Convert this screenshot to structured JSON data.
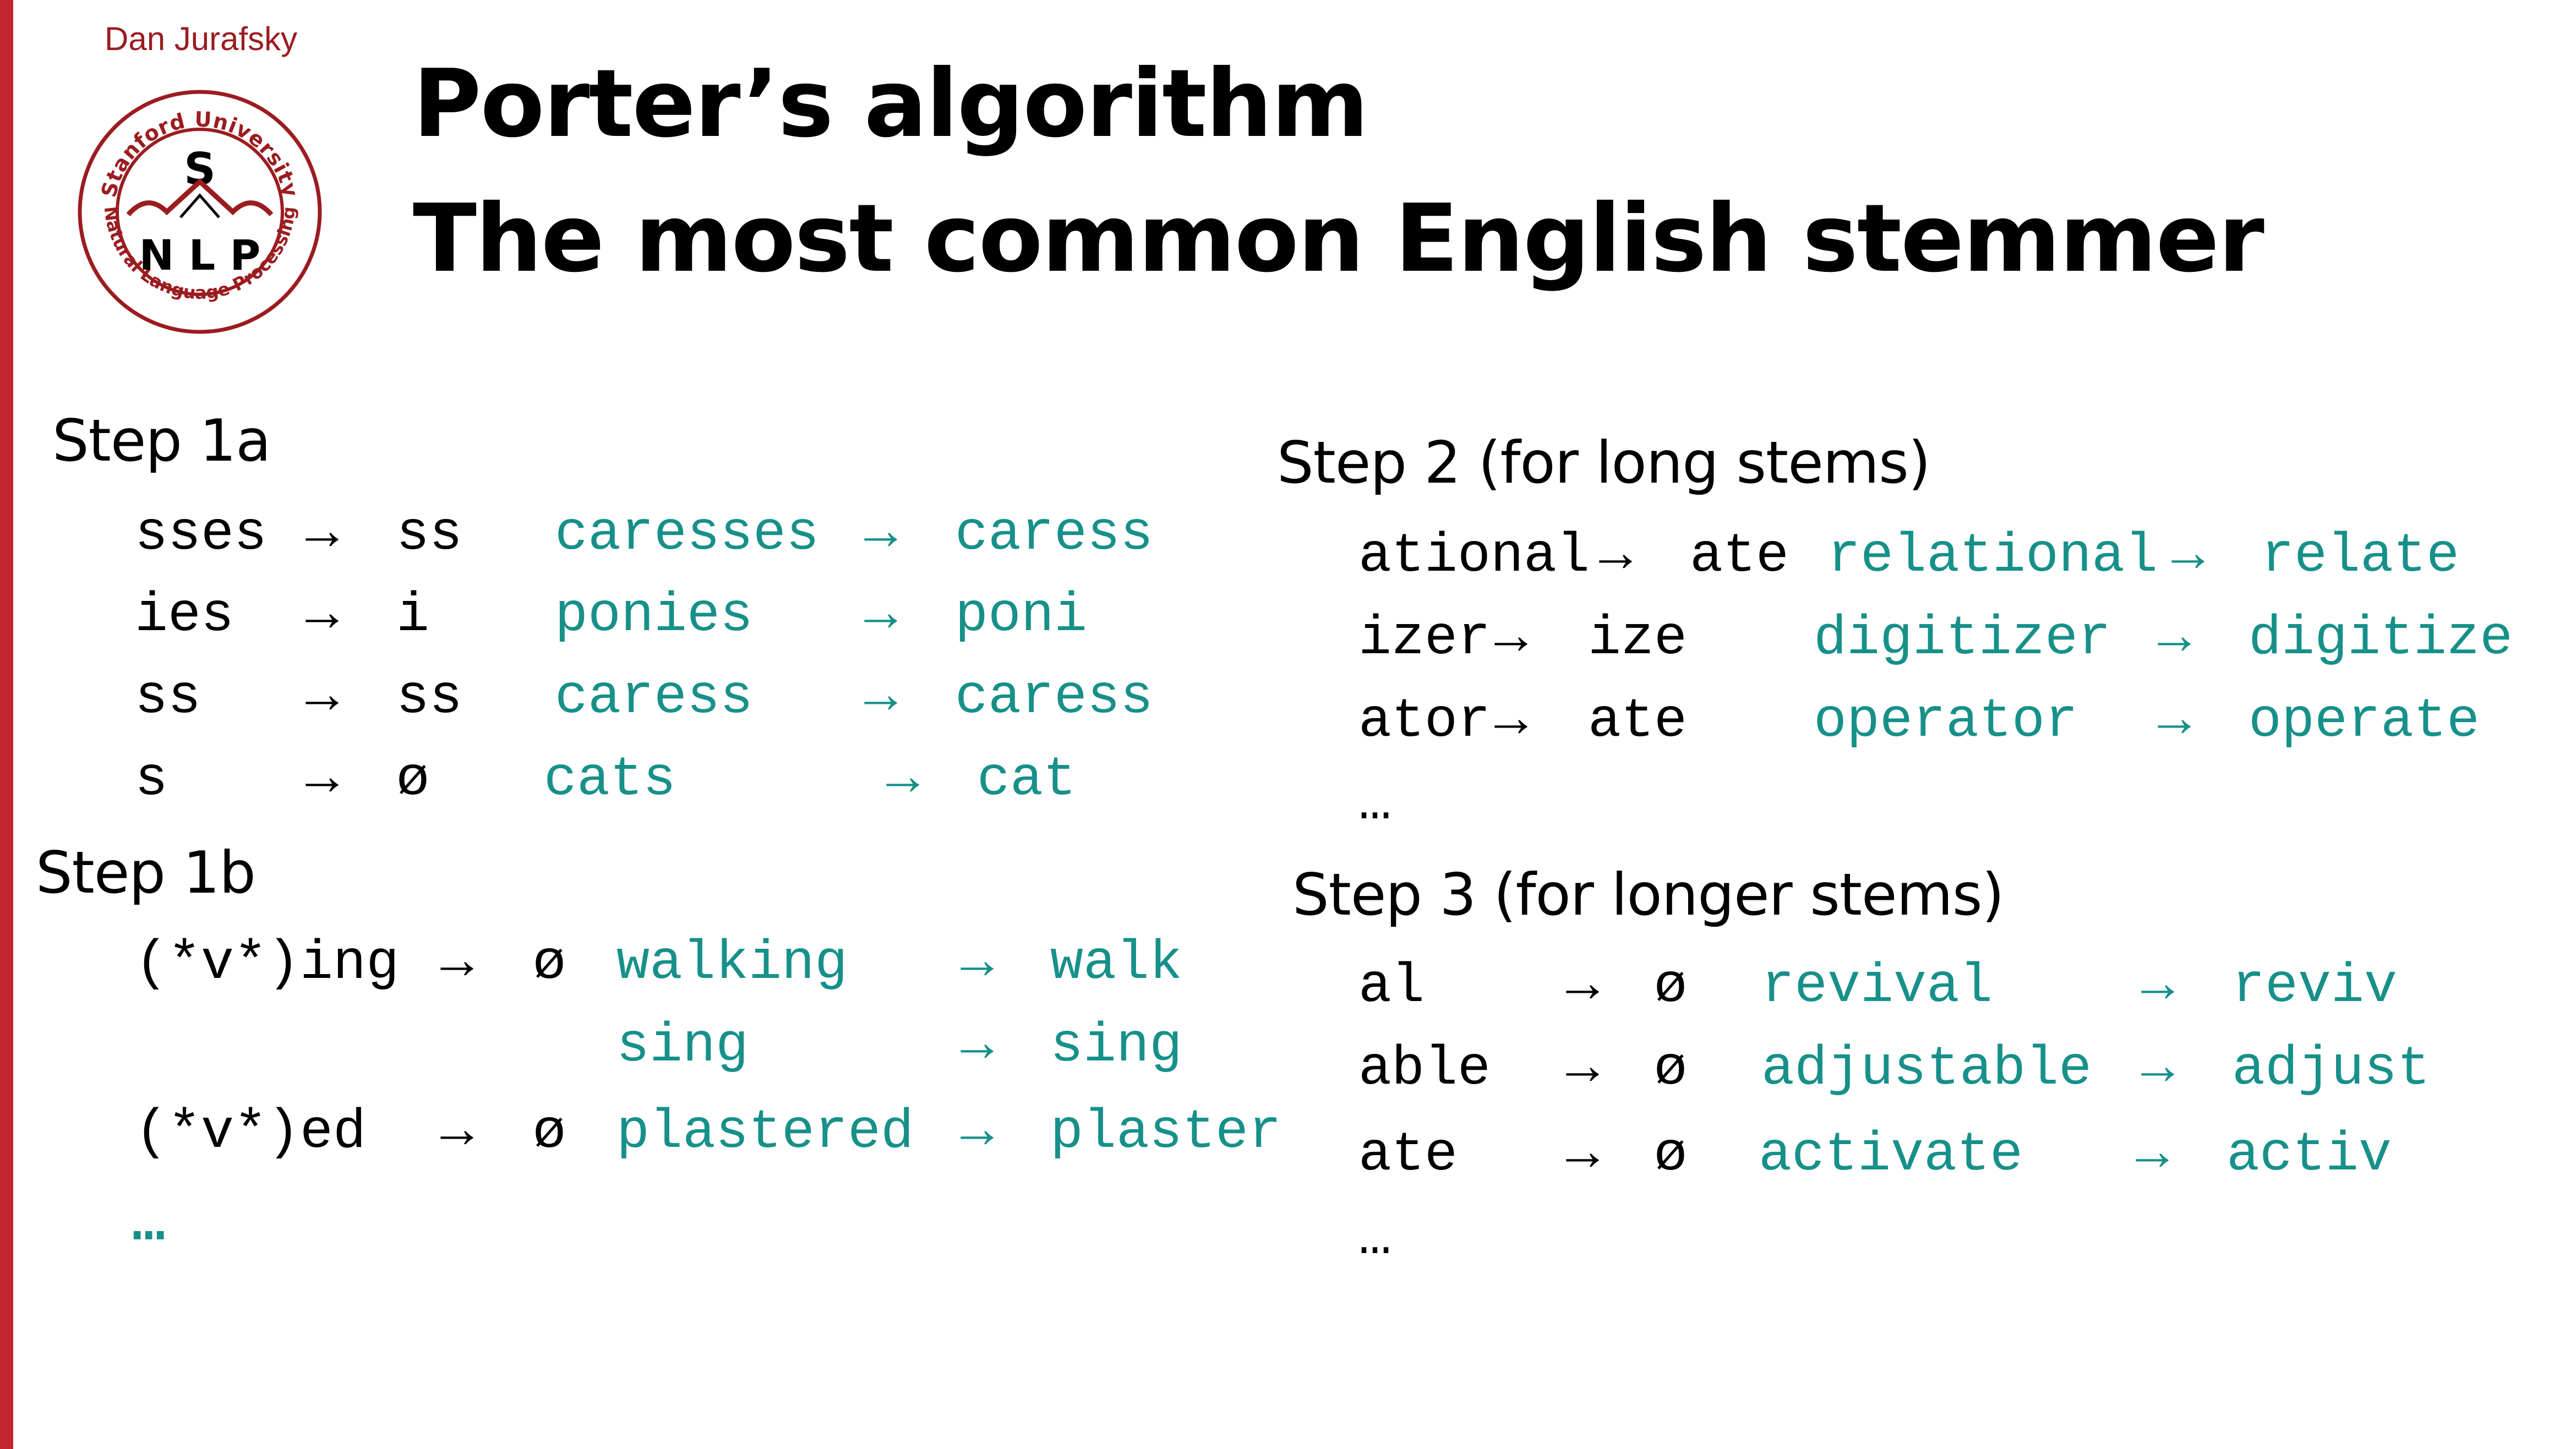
{
  "colors": {
    "accent_red": "#C4262E",
    "logo_red": "#9B1C20",
    "example_teal": "#17908A",
    "text": "#000000"
  },
  "header": {
    "author": "Dan Jurafsky",
    "logo": {
      "top_text": "Stanford University",
      "bottom_text": "Natural Language Processing",
      "letter_top": "S",
      "letters_bottom": "N L P"
    },
    "title_line1": "Porter’s algorithm",
    "title_line2": "The most common English stemmer"
  },
  "step1a": {
    "heading": "Step 1a",
    "rules": [
      {
        "pattern": "sses",
        "arrow": "→",
        "replacement": "ss",
        "example_in": "caresses",
        "example_arrow": "→",
        "example_out": "caress"
      },
      {
        "pattern": "ies",
        "arrow": "→",
        "replacement": "i",
        "example_in": "ponies",
        "example_arrow": "→",
        "example_out": "poni"
      },
      {
        "pattern": "ss",
        "arrow": "→",
        "replacement": "ss",
        "example_in": "caress",
        "example_arrow": "→",
        "example_out": "caress"
      },
      {
        "pattern": "s",
        "arrow": "→",
        "replacement": "ø",
        "example_in": "cats",
        "example_arrow": "→",
        "example_out": "cat"
      }
    ]
  },
  "step1b": {
    "heading": "Step 1b",
    "rules": [
      {
        "pattern": "(*v*)ing",
        "arrow": "→",
        "replacement": "ø",
        "example_in": "walking",
        "example_arrow": "→",
        "example_out": "walk"
      },
      {
        "pattern": "",
        "arrow": "",
        "replacement": "",
        "example_in": "sing",
        "example_arrow": "→",
        "example_out": "sing"
      },
      {
        "pattern": "(*v*)ed",
        "arrow": "→",
        "replacement": "ø",
        "example_in": "plastered",
        "example_arrow": "→",
        "example_out": "plaster"
      }
    ],
    "ellipsis": "…"
  },
  "step2": {
    "heading": "Step 2 (for long stems)",
    "rules": [
      {
        "pattern": "ational",
        "arrow": "→",
        "replacement": "ate",
        "example_in": "relational",
        "example_arrow": "→",
        "example_out": "relate"
      },
      {
        "pattern": "izer",
        "arrow": "→",
        "replacement": "ize",
        "example_in": "digitizer",
        "example_arrow": "→",
        "example_out": "digitize"
      },
      {
        "pattern": "ator",
        "arrow": "→",
        "replacement": "ate",
        "example_in": "operator",
        "example_arrow": "→",
        "example_out": "operate"
      }
    ],
    "ellipsis": "…"
  },
  "step3": {
    "heading": "Step 3 (for longer stems)",
    "rules": [
      {
        "pattern": "al",
        "arrow": "→",
        "replacement": "ø",
        "example_in": "revival",
        "example_arrow": "→",
        "example_out": "reviv"
      },
      {
        "pattern": "able",
        "arrow": "→",
        "replacement": "ø",
        "example_in": "adjustable",
        "example_arrow": "→",
        "example_out": "adjust"
      },
      {
        "pattern": "ate",
        "arrow": "→",
        "replacement": "ø",
        "example_in": "activate",
        "example_arrow": "→",
        "example_out": "activ"
      }
    ],
    "ellipsis": "…"
  }
}
